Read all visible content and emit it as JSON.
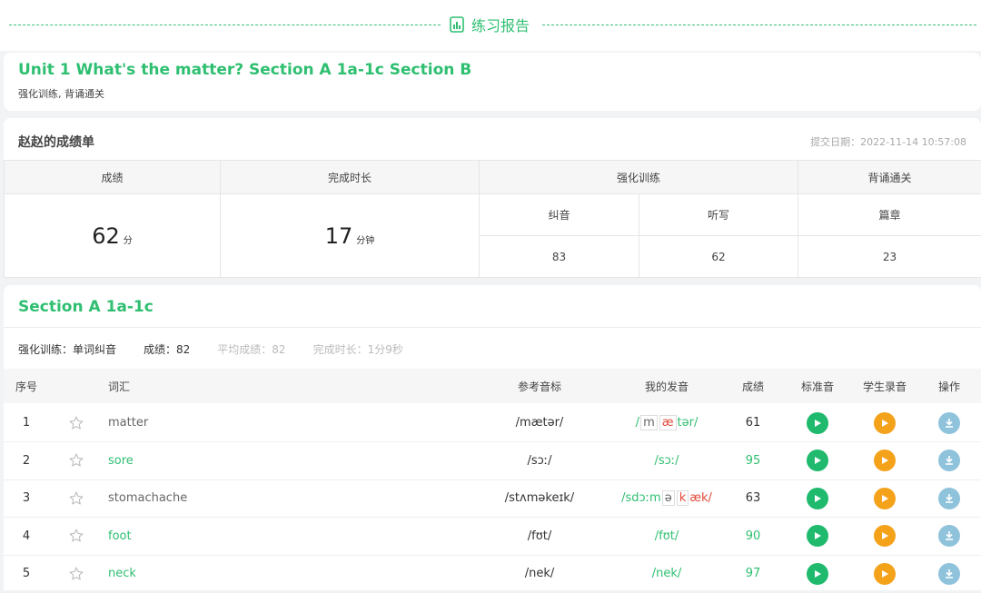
{
  "header": {
    "title": "练习报告"
  },
  "unit": {
    "title": "Unit 1 What's the matter? Section A 1a-1c Section B",
    "subtitle": "强化训练, 背诵通关"
  },
  "report": {
    "title": "赵赵的成绩单",
    "submit_date": "提交日期：2022-11-14 10:57:08",
    "headers": {
      "score": "成绩",
      "duration": "完成时长",
      "training": "强化训练",
      "recite": "背诵通关"
    },
    "sub_headers": {
      "correction": "纠音",
      "dictation": "听写",
      "passage": "篇章"
    },
    "score_value": "62",
    "score_unit": "分",
    "duration_value": "17",
    "duration_unit": "分钟",
    "correction_value": "83",
    "dictation_value": "62",
    "passage_value": "23"
  },
  "section": {
    "title": "Section A 1a-1c",
    "training_label": "强化训练：单词纠音",
    "score_label": "成绩：82",
    "avg_label": "平均成绩：82",
    "duration_label": "完成时长：1分9秒",
    "columns": {
      "index": "序号",
      "word": "词汇",
      "ref": "参考音标",
      "mine": "我的发音",
      "score": "成绩",
      "std": "标准音",
      "stu": "学生录音",
      "op": "操作"
    },
    "rows": [
      {
        "index": "1",
        "word": "matter",
        "ref": "/mætər/",
        "mine": [
          "/",
          "m",
          "æ",
          "tər/"
        ],
        "score": "61",
        "good": false
      },
      {
        "index": "2",
        "word": "sore",
        "ref": "/sɔː/",
        "mine": [
          "/sɔː/"
        ],
        "score": "95",
        "good": true
      },
      {
        "index": "3",
        "word": "stomachache",
        "ref": "/stʌməkeɪk/",
        "mine": [
          "/sdɔːm",
          "ə",
          "k",
          "æk/"
        ],
        "score": "63",
        "good": false
      },
      {
        "index": "4",
        "word": "foot",
        "ref": "/fʊt/",
        "mine": [
          "/fʊt/"
        ],
        "score": "90",
        "good": true
      },
      {
        "index": "5",
        "word": "neck",
        "ref": "/nek/",
        "mine": [
          "/nek/"
        ],
        "score": "97",
        "good": true
      }
    ]
  },
  "icons": {
    "report": "report-icon",
    "star": "star-icon",
    "play": "play-icon",
    "download": "download-icon"
  },
  "colors": {
    "accent": "#2fbf71",
    "play_standard": "#1fba6d",
    "play_student": "#f5a21b",
    "download": "#8fc3dc",
    "error": "#e24a3b"
  }
}
